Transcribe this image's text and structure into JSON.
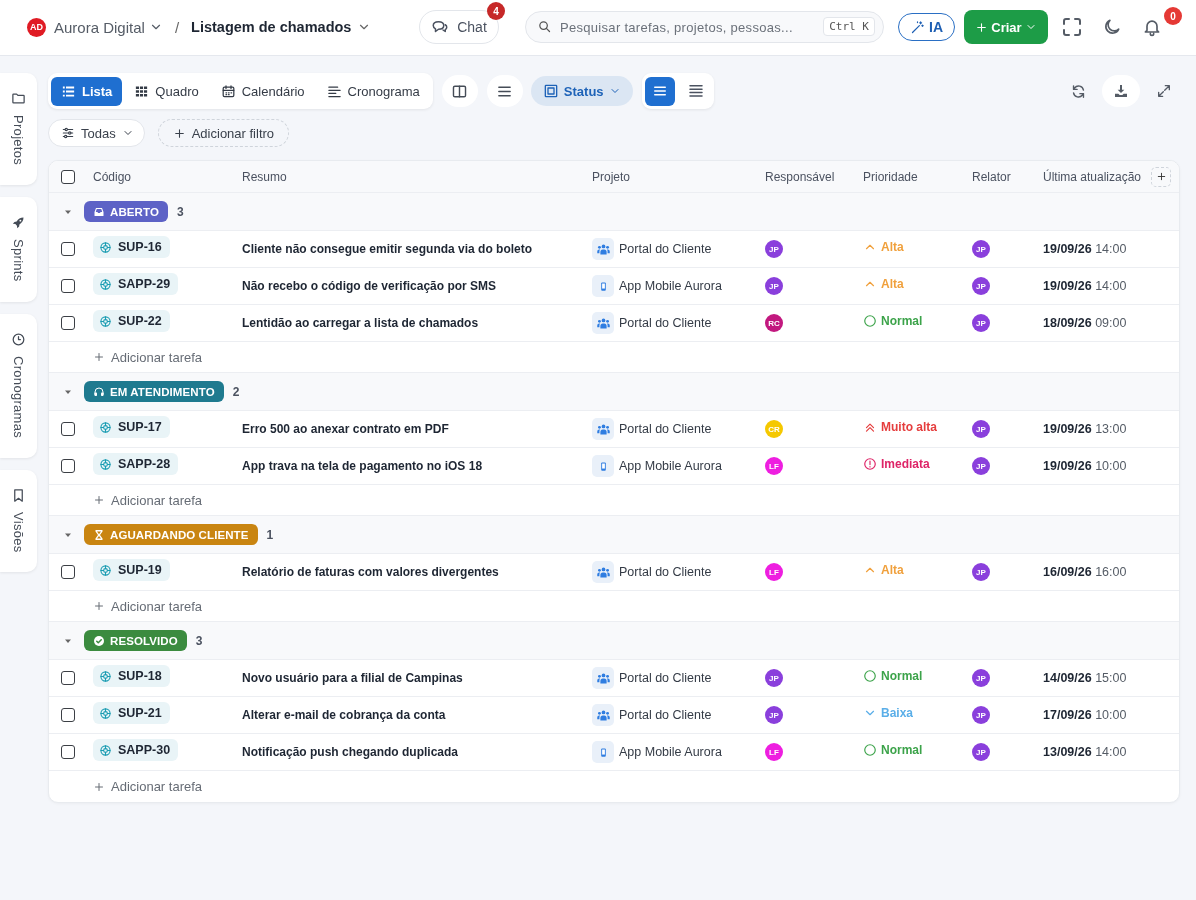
{
  "header": {
    "logo": "AD",
    "workspace": "Aurora Digital",
    "separator": "/",
    "page_title": "Listagem de chamados",
    "chat": {
      "label": "Chat",
      "badge": "4"
    },
    "search": {
      "placeholder": "Pesquisar tarefas, projetos, pessoas...",
      "shortcut": "Ctrl K"
    },
    "ai_button": "IA",
    "create_button": "Criar",
    "notifications": {
      "badge": "0"
    }
  },
  "side_tabs": [
    {
      "label": "Projetos",
      "kind": "folder"
    },
    {
      "label": "Sprints",
      "kind": "rocket"
    },
    {
      "label": "Cronogramas",
      "kind": "clock"
    },
    {
      "label": "Visões",
      "kind": "bookmark"
    }
  ],
  "views": [
    {
      "label": "Lista",
      "kind": "list",
      "selected": true
    },
    {
      "label": "Quadro",
      "kind": "board",
      "selected": false
    },
    {
      "label": "Calendário",
      "kind": "calendar",
      "selected": false
    },
    {
      "label": "Cronograma",
      "kind": "timeline",
      "selected": false
    }
  ],
  "group_by": {
    "label": "Status"
  },
  "density": [
    {
      "kind": "comfortable",
      "selected": true
    },
    {
      "kind": "compact",
      "selected": false
    }
  ],
  "filters": {
    "scope": "Todas",
    "add_filter": "Adicionar filtro"
  },
  "table": {
    "select_all": {
      "checked": false
    },
    "columns": [
      "Código",
      "Resumo",
      "Projeto",
      "Responsável",
      "Prioridade",
      "Relator",
      "Última atualização"
    ],
    "groups": [
      {
        "status": "ABERTO",
        "kind": "open",
        "color": "#5d62c6",
        "count": "3",
        "expanded": true,
        "add_task": "Adicionar tarefa",
        "rows": [
          {
            "checked": false,
            "code": "SUP-16",
            "summary": "Cliente não consegue emitir segunda via do boleto",
            "project": {
              "name": "Portal do Cliente",
              "kind": "team"
            },
            "assignee": {
              "initials": "JP",
              "color": "#8a3fdc"
            },
            "priority": {
              "label": "Alta",
              "kind": "high"
            },
            "reporter": {
              "initials": "JP",
              "color": "#8a3fdc"
            },
            "updated": "**19/09/26** 14:00"
          },
          {
            "checked": false,
            "code": "SAPP-29",
            "summary": "Não recebo o código de verificação por SMS",
            "project": {
              "name": "App Mobile Aurora",
              "kind": "mobile"
            },
            "assignee": {
              "initials": "JP",
              "color": "#8a3fdc"
            },
            "priority": {
              "label": "Alta",
              "kind": "high"
            },
            "reporter": {
              "initials": "JP",
              "color": "#8a3fdc"
            },
            "updated": "**19/09/26** 14:00"
          },
          {
            "checked": false,
            "code": "SUP-22",
            "summary": "Lentidão ao carregar a lista de chamados",
            "project": {
              "name": "Portal do Cliente",
              "kind": "team"
            },
            "assignee": {
              "initials": "RC",
              "color": "#c2187f"
            },
            "priority": {
              "label": "Normal",
              "kind": "normal"
            },
            "reporter": {
              "initials": "JP",
              "color": "#8a3fdc"
            },
            "updated": "**18/09/26** 09:00"
          }
        ]
      },
      {
        "status": "EM ATENDIMENTO",
        "kind": "in_progress",
        "color": "#1f7a8f",
        "count": "2",
        "expanded": true,
        "add_task": "Adicionar tarefa",
        "rows": [
          {
            "checked": false,
            "code": "SUP-17",
            "summary": "Erro 500 ao anexar contrato em PDF",
            "project": {
              "name": "Portal do Cliente",
              "kind": "team"
            },
            "assignee": {
              "initials": "CR",
              "color": "#f5c800"
            },
            "priority": {
              "label": "Muito alta",
              "kind": "very_high"
            },
            "reporter": {
              "initials": "JP",
              "color": "#8a3fdc"
            },
            "updated": "**19/09/26** 13:00"
          },
          {
            "checked": false,
            "code": "SAPP-28",
            "summary": "App trava na tela de pagamento no iOS 18",
            "project": {
              "name": "App Mobile Aurora",
              "kind": "mobile"
            },
            "assignee": {
              "initials": "LF",
              "color": "#ee1ee0"
            },
            "priority": {
              "label": "Imediata",
              "kind": "immediate"
            },
            "reporter": {
              "initials": "JP",
              "color": "#8a3fdc"
            },
            "updated": "**19/09/26** 10:00"
          }
        ]
      },
      {
        "status": "AGUARDANDO CLIENTE",
        "kind": "waiting",
        "color": "#c98511",
        "count": "1",
        "expanded": true,
        "add_task": "Adicionar tarefa",
        "rows": [
          {
            "checked": false,
            "code": "SUP-19",
            "summary": "Relatório de faturas com valores divergentes",
            "project": {
              "name": "Portal do Cliente",
              "kind": "team"
            },
            "assignee": {
              "initials": "LF",
              "color": "#ee1ee0"
            },
            "priority": {
              "label": "Alta",
              "kind": "high"
            },
            "reporter": {
              "initials": "JP",
              "color": "#8a3fdc"
            },
            "updated": "**16/09/26** 16:00"
          }
        ]
      },
      {
        "status": "RESOLVIDO",
        "kind": "resolved",
        "color": "#3b8b3f",
        "count": "3",
        "expanded": true,
        "add_task": "Adicionar tarefa",
        "rows": [
          {
            "checked": false,
            "code": "SUP-18",
            "summary": "Novo usuário para a filial de Campinas",
            "project": {
              "name": "Portal do Cliente",
              "kind": "team"
            },
            "assignee": {
              "initials": "JP",
              "color": "#8a3fdc"
            },
            "priority": {
              "label": "Normal",
              "kind": "normal"
            },
            "reporter": {
              "initials": "JP",
              "color": "#8a3fdc"
            },
            "updated": "**14/09/26** 15:00"
          },
          {
            "checked": false,
            "code": "SUP-21",
            "summary": "Alterar e-mail de cobrança da conta",
            "project": {
              "name": "Portal do Cliente",
              "kind": "team"
            },
            "assignee": {
              "initials": "JP",
              "color": "#8a3fdc"
            },
            "priority": {
              "label": "Baixa",
              "kind": "low"
            },
            "reporter": {
              "initials": "JP",
              "color": "#8a3fdc"
            },
            "updated": "**17/09/26** 10:00"
          },
          {
            "checked": false,
            "code": "SAPP-30",
            "summary": "Notificação push chegando duplicada",
            "project": {
              "name": "App Mobile Aurora",
              "kind": "mobile"
            },
            "assignee": {
              "initials": "LF",
              "color": "#ee1ee0"
            },
            "priority": {
              "label": "Normal",
              "kind": "normal"
            },
            "reporter": {
              "initials": "JP",
              "color": "#8a3fdc"
            },
            "updated": "**13/09/26** 14:00"
          }
        ]
      }
    ]
  }
}
